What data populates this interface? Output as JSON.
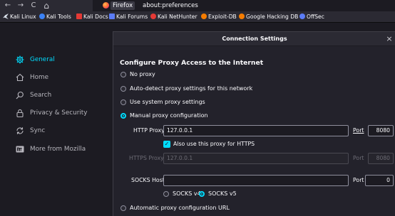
{
  "browser": {
    "nav": {
      "back": "←",
      "forward": "→",
      "reload": "C",
      "home": "⌂"
    },
    "tab_badge": "Firefox",
    "url": "about:preferences"
  },
  "bookmarks": [
    {
      "label": "Kali Linux",
      "icon": "kali-dragon-icon",
      "color": "#d9e0ea"
    },
    {
      "label": "Kali Tools",
      "icon": "kali-tools-icon",
      "color": "#3b82f6"
    },
    {
      "label": "Kali Docs",
      "icon": "kali-docs-icon",
      "color": "#e53935"
    },
    {
      "label": "Kali Forums",
      "icon": "kali-forums-icon",
      "color": "#5b7cf6"
    },
    {
      "label": "Kali NetHunter",
      "icon": "nethunter-icon",
      "color": "#e53935"
    },
    {
      "label": "Exploit-DB",
      "icon": "exploit-db-icon",
      "color": "#f57c00"
    },
    {
      "label": "Google Hacking DB",
      "icon": "ghdb-icon",
      "color": "#f57c00"
    },
    {
      "label": "OffSec",
      "icon": "offsec-icon",
      "color": "#5b7cf6"
    }
  ],
  "sidebar": {
    "items": [
      {
        "label": "General",
        "icon": "gear-icon",
        "active": true
      },
      {
        "label": "Home",
        "icon": "home-icon"
      },
      {
        "label": "Search",
        "icon": "search-icon"
      },
      {
        "label": "Privacy & Security",
        "icon": "lock-icon"
      },
      {
        "label": "Sync",
        "icon": "sync-icon"
      },
      {
        "label": "More from Mozilla",
        "icon": "mozilla-m-icon"
      }
    ]
  },
  "dialog": {
    "title": "Connection Settings",
    "close": "×",
    "heading": "Configure Proxy Access to the Internet",
    "options": {
      "no_proxy": "No proxy",
      "auto_detect": "Auto-detect proxy settings for this network",
      "system": "Use system proxy settings",
      "manual": "Manual proxy configuration",
      "auto_url": "Automatic proxy configuration URL"
    },
    "selected": "manual",
    "http": {
      "label": "HTTP Proxy",
      "value": "127.0.0.1",
      "port_label": "Port",
      "port": "8080"
    },
    "also_https": {
      "label": "Also use this proxy for HTTPS",
      "checked": true
    },
    "https": {
      "label": "HTTPS Proxy",
      "value": "127.0.0.1",
      "port_label": "Port",
      "port": "8080"
    },
    "socks": {
      "label": "SOCKS Host",
      "value": "",
      "port_label": "Port",
      "port": "0"
    },
    "socks_version": {
      "v4": "SOCKS v4",
      "v5": "SOCKS v5",
      "selected": "v5"
    },
    "accent": "#00ddff"
  }
}
